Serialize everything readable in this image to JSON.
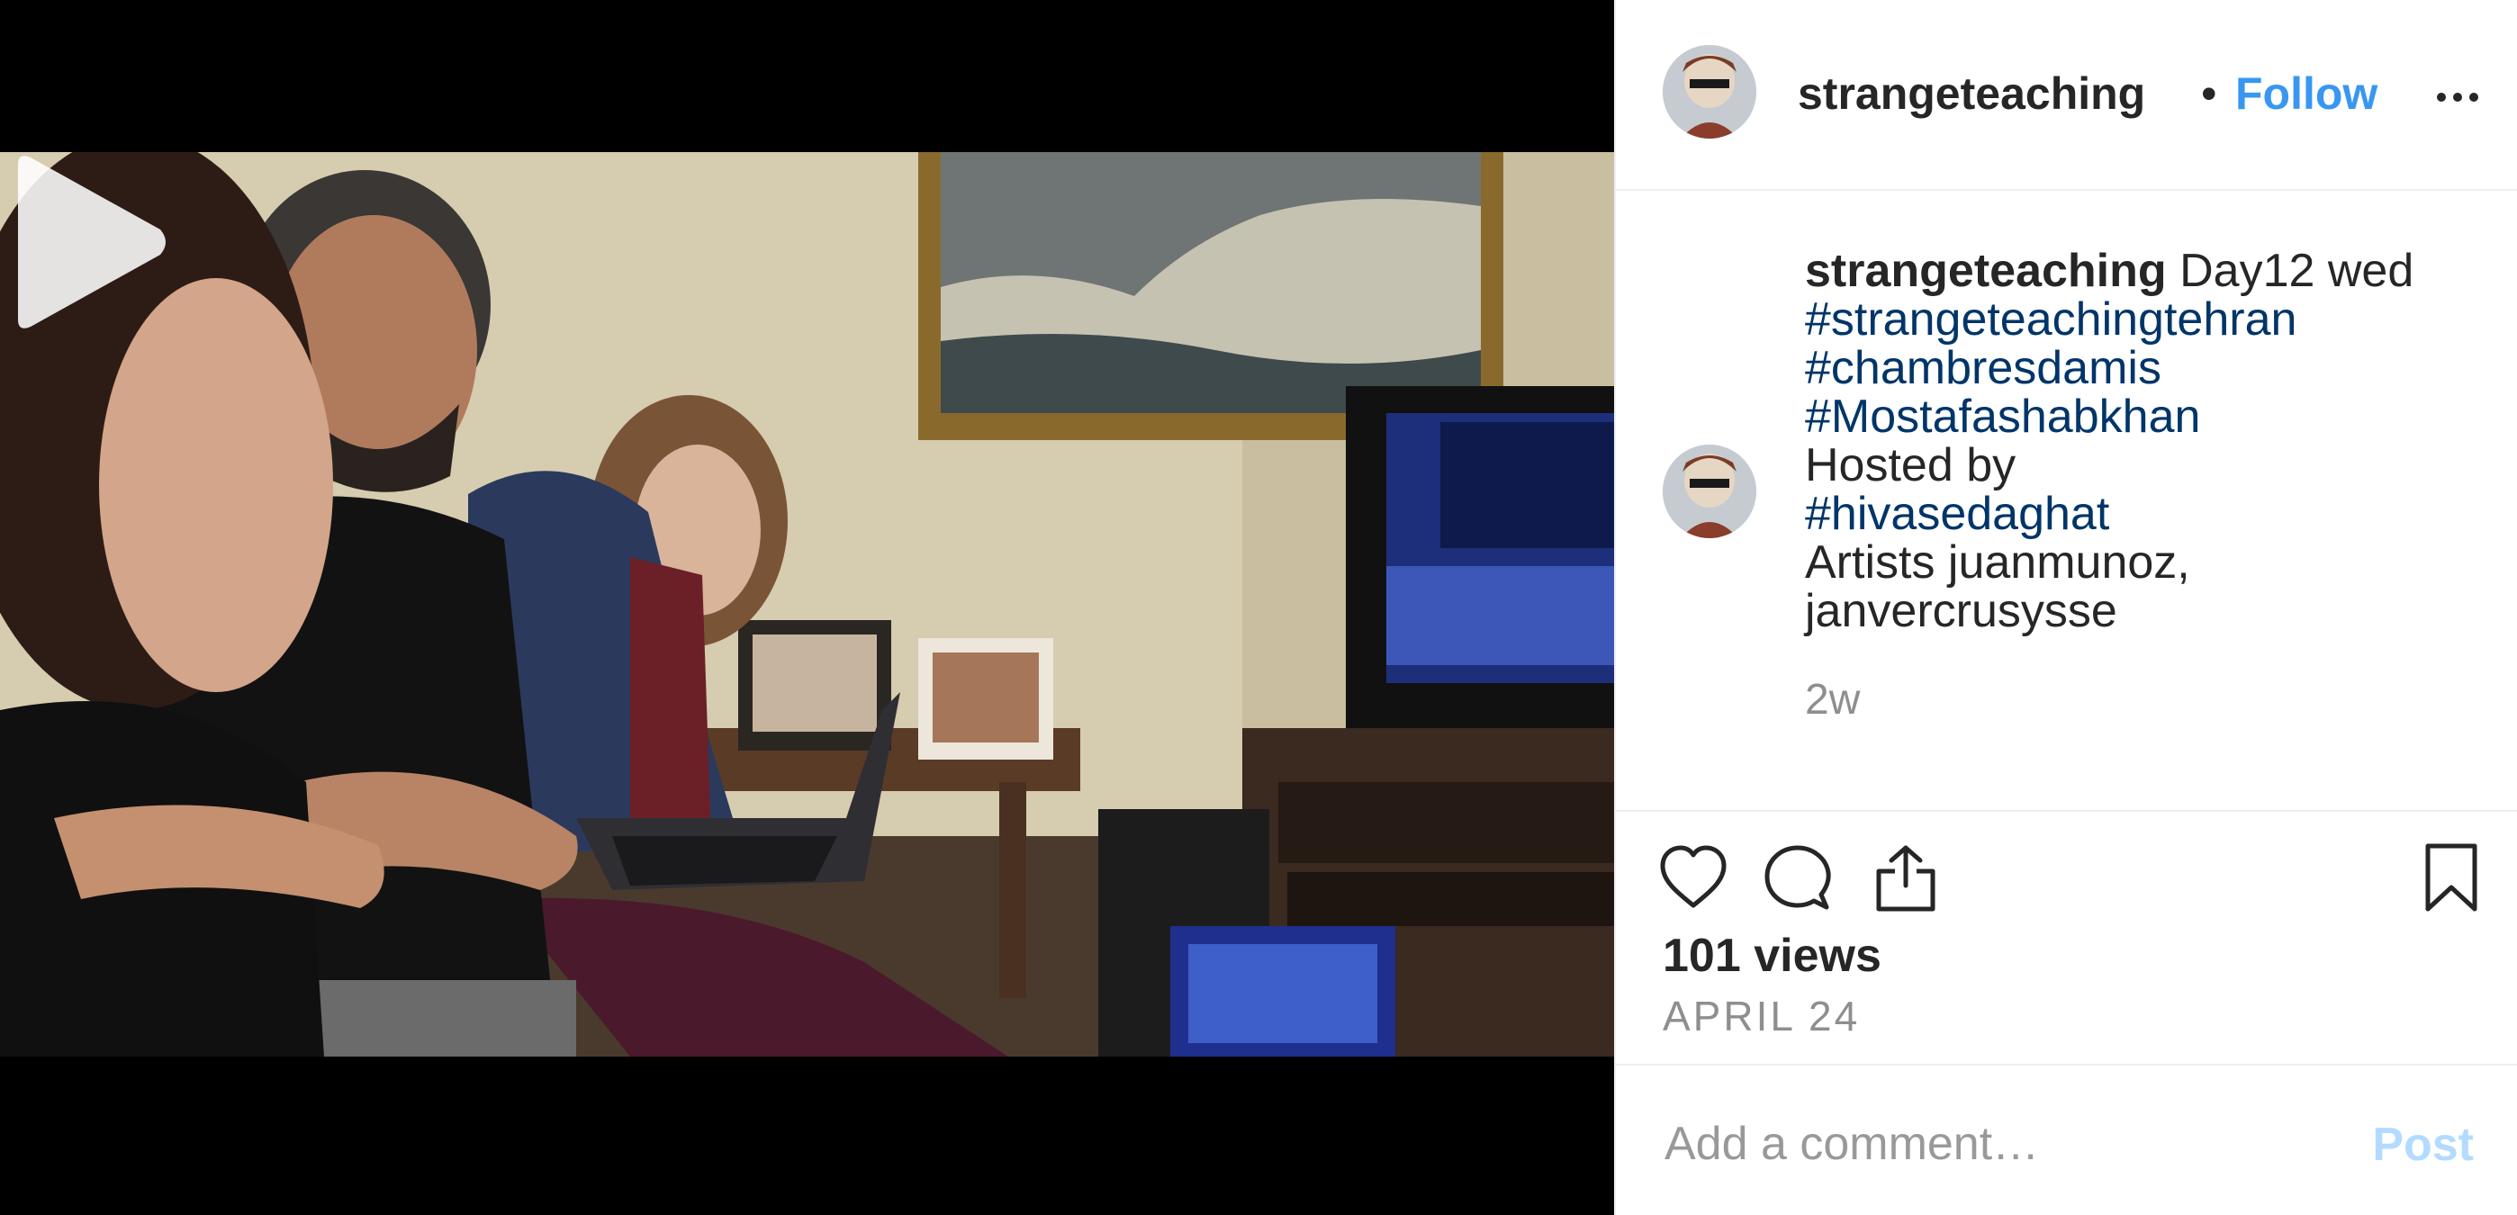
{
  "header": {
    "username": "strangeteaching",
    "separator": "•",
    "follow_label": "Follow",
    "more_icon": "more-horizontal-icon"
  },
  "caption": {
    "username": "strangeteaching",
    "text_first": " Day12 wed",
    "hashtags": [
      "#strangeteachingtehran",
      "#chambresdamis",
      "#Mostafashabkhan"
    ],
    "hosted_by": "Hosted by",
    "host_tag": "#hivasedaghat",
    "artists_prefix": "Artists ",
    "artist_1": "juanmunoz",
    "artist_sep": ",",
    "artist_2": "janvercrusysse",
    "time_ago": "2w"
  },
  "actions": {
    "like_icon": "heart-icon",
    "comment_icon": "comment-bubble-icon",
    "share_icon": "share-upload-icon",
    "save_icon": "bookmark-icon",
    "views": "101 views",
    "date": "APRIL 24"
  },
  "comment": {
    "placeholder": "Add a comment…",
    "post_label": "Post"
  },
  "colors": {
    "link_blue": "#3897f0",
    "hashtag_blue": "#003569",
    "muted_gray": "#8e8e8e",
    "post_disabled": "#b3dbff"
  },
  "media": {
    "type": "video",
    "play_icon": "play-icon"
  }
}
